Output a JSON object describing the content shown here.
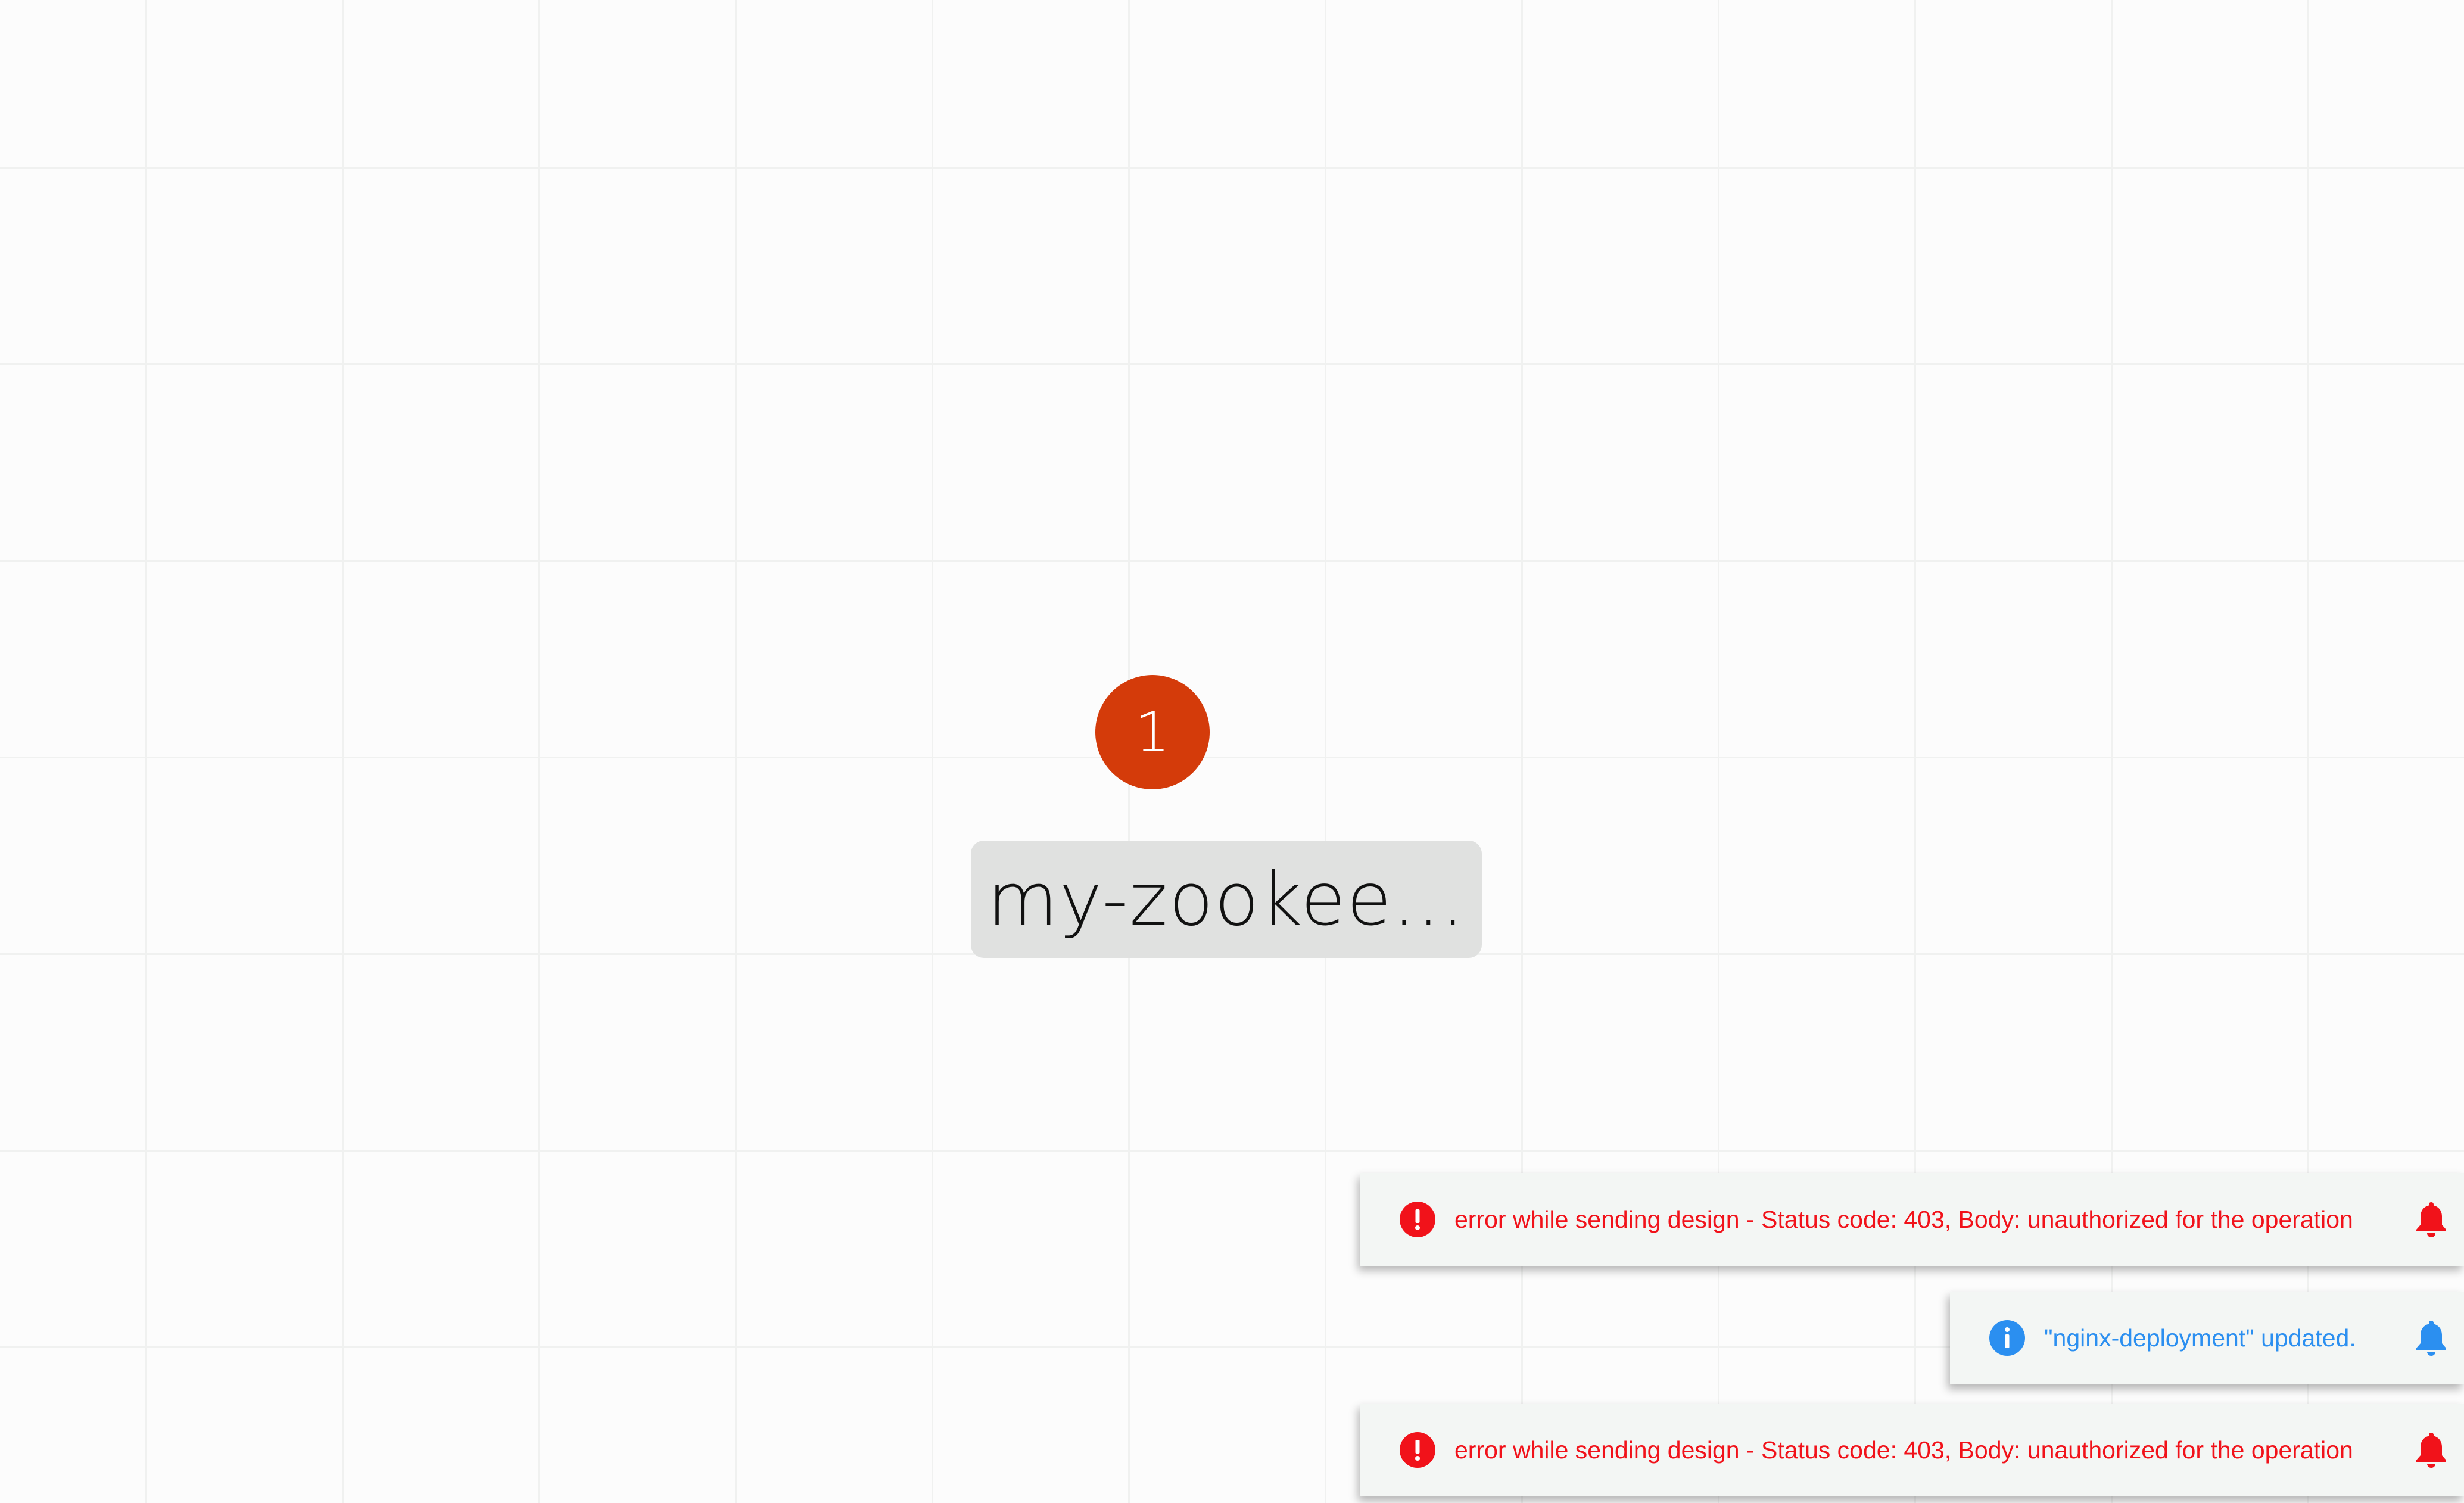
{
  "canvas": {
    "node": {
      "badge_count": "1",
      "label": "my-zookee..."
    }
  },
  "notifications": [
    {
      "type": "error",
      "icon": "error-icon",
      "message": "error while sending design - Status code: 403, Body: unauthorized for the operation",
      "action_icon": "bell-icon",
      "color": "#f1121a"
    },
    {
      "type": "info",
      "icon": "info-icon",
      "message": "\"nginx-deployment\" updated.",
      "action_icon": "bell-icon",
      "color": "#2b8ff0"
    },
    {
      "type": "error",
      "icon": "error-icon",
      "message": "error while sending design - Status code: 403, Body: unauthorized for the operation",
      "action_icon": "bell-icon",
      "color": "#f1121a"
    }
  ],
  "colors": {
    "badge": "#d43b0a",
    "node_label_bg": "#e0e1e0",
    "grid_line": "#f0f1f0",
    "canvas_bg": "#fcfcfc",
    "toast_bg": "#f3f6f4"
  }
}
